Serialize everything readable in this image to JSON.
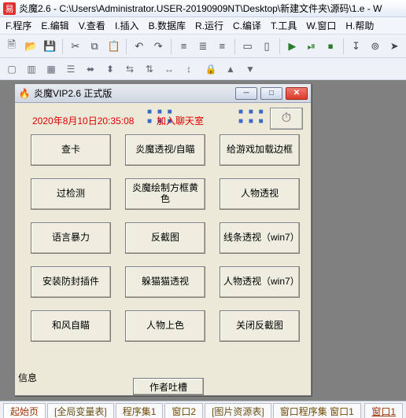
{
  "window": {
    "title": "炎魔2.6 - C:\\Users\\Administrator.USER-20190909NT\\Desktop\\新建文件夹\\源码\\1.e - W",
    "app_icon": "易"
  },
  "menu": {
    "items": [
      "F.程序",
      "E.编辑",
      "V.查看",
      "I.插入",
      "B.数据库",
      "R.运行",
      "C.编译",
      "T.工具",
      "W.窗口",
      "H.帮助"
    ]
  },
  "toolbar1": {
    "icons": [
      "new",
      "open",
      "save",
      "sep",
      "cut",
      "copy",
      "paste",
      "sep",
      "undo",
      "redo",
      "sep",
      "align-left",
      "align-center",
      "align-right",
      "sep",
      "doc",
      "docs",
      "sep",
      "run",
      "run-to",
      "stop",
      "sep",
      "step",
      "record",
      "arrow"
    ]
  },
  "toolbar2": {
    "icons": [
      "box",
      "boxes",
      "grid",
      "stack",
      "h-align",
      "v-align",
      "center-h",
      "center-v",
      "dist-h",
      "dist-v",
      "sep",
      "lock",
      "bring-front",
      "send-back",
      "sep",
      "help"
    ]
  },
  "child": {
    "title": "炎魔VIP2.6 正式版",
    "timestamp": "2020年8月10日20:35:08",
    "join_chat": "加入聊天室",
    "clock_icon": "⏱",
    "buttons": [
      "查卡",
      "炎魔透视/自瞄",
      "给游戏加载边框",
      "过检测",
      "炎魔绘制方框黄色",
      "人物透视",
      "语言暴力",
      "反截图",
      "线条透视（win7）",
      "安装防封插件",
      "躲猫猫透视",
      "人物透视（win7）",
      "和风自瞄",
      "人物上色",
      "关闭反截图"
    ],
    "info_label": "信息",
    "author_btn": "作者吐槽"
  },
  "tabs": {
    "items": [
      "起始页",
      "[全局变量表]",
      "程序集1",
      "窗口2",
      "[图片资源表]",
      "窗口程序集 窗口1"
    ],
    "right": "窗口1"
  }
}
